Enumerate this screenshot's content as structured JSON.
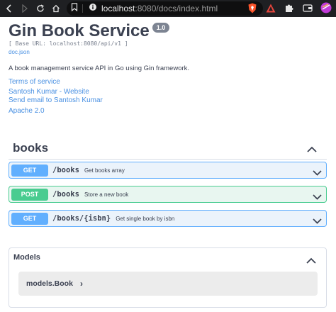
{
  "browser": {
    "url_host": "localhost",
    "url_rest": ":8080/docs/index.html"
  },
  "page": {
    "title": "Gin Book Service",
    "version": "1.0",
    "base_url": "[ Base URL: localhost:8080/api/v1 ]",
    "doc_link": "doc.json",
    "description": "A book management service API in Go using Gin framework.",
    "terms": "Terms of service",
    "contact_website": "Santosh Kumar - Website",
    "contact_email": "Send email to Santosh Kumar",
    "license": "Apache 2.0"
  },
  "tag": {
    "name": "books"
  },
  "operations": [
    {
      "method": "GET",
      "path": "/books",
      "summary": "Get books array"
    },
    {
      "method": "POST",
      "path": "/books",
      "summary": "Store a new book"
    },
    {
      "method": "GET",
      "path": "/books/{isbn}",
      "summary": "Get single book by isbn"
    }
  ],
  "models": {
    "title": "Models",
    "items": [
      {
        "name": "models.Book"
      }
    ]
  },
  "colors": {
    "get": "#61affe",
    "post": "#49cc90",
    "link": "#4990e2"
  }
}
